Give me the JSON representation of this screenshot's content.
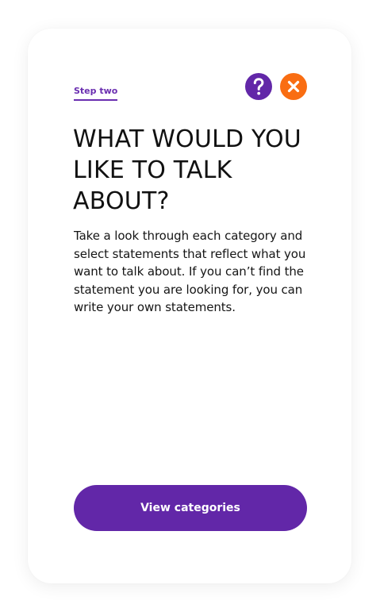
{
  "step": {
    "label": "Step two"
  },
  "header": {
    "help_icon": "question-mark-icon",
    "close_icon": "close-x-icon"
  },
  "main": {
    "title": "WHAT WOULD YOU LIKE TO TALK ABOUT?",
    "description": "Take a look through each category and select statements that reflect what you want to talk about. If you can’t find the statement you are looking for, you can write your own statements."
  },
  "actions": {
    "view_categories_label": "View categories"
  },
  "colors": {
    "primary": "#6227a8",
    "accent": "#f96d12",
    "text": "#111111",
    "background": "#ffffff"
  }
}
